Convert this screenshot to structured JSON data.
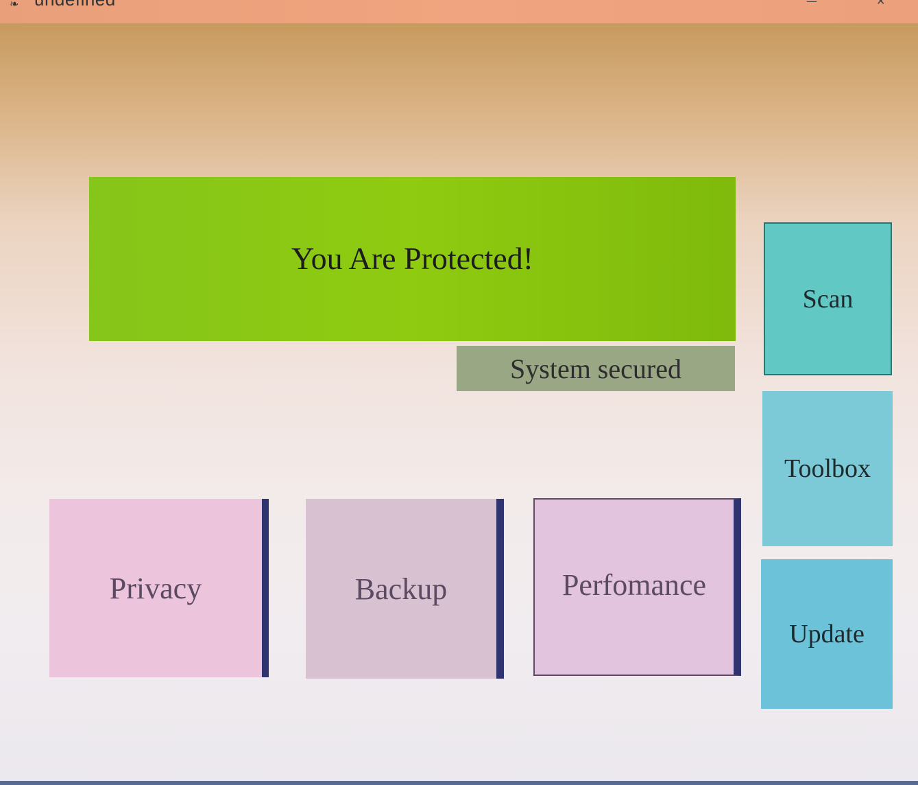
{
  "window": {
    "title": "undefined",
    "controls": [
      "minimize",
      "close"
    ]
  },
  "banner": {
    "text": "You Are Protected!",
    "color": "#8fcb10"
  },
  "status": {
    "text": "System secured"
  },
  "side_buttons": [
    {
      "label": "Scan",
      "color": "#62c8c4"
    },
    {
      "label": "Toolbox",
      "color": "#7cc9d8"
    },
    {
      "label": "Update",
      "color": "#6cc2d8"
    }
  ],
  "feature_tiles": [
    {
      "label": "Privacy",
      "color": "#ecc4dc"
    },
    {
      "label": "Backup",
      "color": "#d8c2d2"
    },
    {
      "label": "Perfomance",
      "color": "#e2c4de"
    }
  ],
  "colors": {
    "tile_accent": "#2f3470"
  }
}
